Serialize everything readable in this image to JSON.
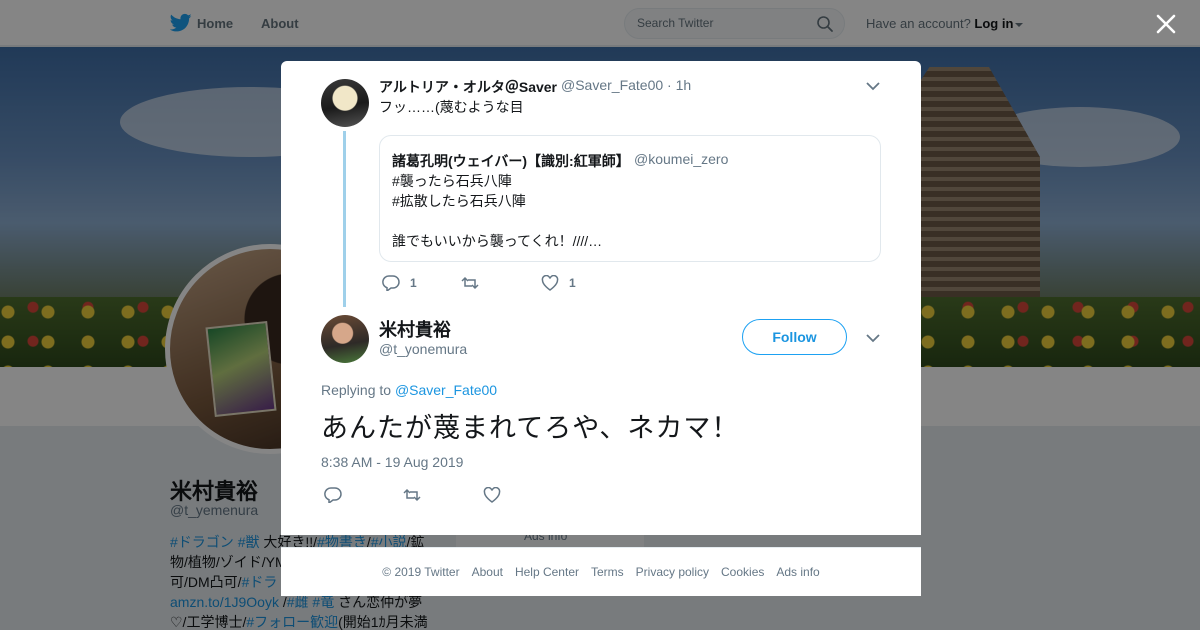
{
  "topbar": {
    "home_label": "Home",
    "about_label": "About",
    "search_placeholder": "Search Twitter",
    "have_account": "Have an account?",
    "login_label": "Log in"
  },
  "profile": {
    "name": "米村貴裕",
    "handle": "@t_yemenura",
    "bio": {
      "l1a": "#ドラゴン",
      "l1b": "#獣",
      "l1c": " 大好き!!/",
      "l1d": "#物書き",
      "l1e": "/",
      "l1f": "#小説",
      "l1g": "/鉱",
      "l2": "物/植物/ゾイド/YM",
      "l3a": "可/DM凸可/",
      "l3b": "#ドラ",
      "l4a": "amzn.to/1J9Ooyk",
      "l4b": " /",
      "l4c": "#雌",
      "l4d": " ",
      "l4e": "#竜",
      "l4f": " さん恋仲が夢",
      "l5a": "♡/工学博士/",
      "l5b": "#フォロー歓迎",
      "l5c": "(開始1ｶ月未満"
    }
  },
  "side": {
    "ads_info": "Ads info"
  },
  "modal": {
    "tweet1": {
      "name": "アルトリア・オルタ＠Saver",
      "handle": "@Saver_Fate00 · 1h",
      "text": "フッ……(蔑むような目",
      "quote": {
        "name": "諸葛孔明(ウェイバー)【識別:紅軍師】",
        "handle": "@koumei_zero",
        "line1": "#襲ったら石兵八陣",
        "line2": "#拡散したら石兵八陣",
        "line3": "誰でもいいから襲ってくれ！////…"
      },
      "reply_count": "1",
      "like_count": "1"
    },
    "tweet2": {
      "name": "米村貴裕",
      "handle": "@t_yonemura",
      "follow_label": "Follow",
      "replying_prefix": "Replying to",
      "replying_handle": "@Saver_Fate00",
      "text": "あんたが蔑まれてろや、ネカマ！",
      "timestamp": "8:38 AM - 19 Aug 2019"
    }
  },
  "footer": {
    "links": [
      "© 2019 Twitter",
      "About",
      "Help Center",
      "Terms",
      "Privacy policy",
      "Cookies",
      "Ads info"
    ]
  },
  "colors": {
    "brand": "#1da1f2",
    "link": "#1b95e0",
    "muted": "#657786",
    "thread": "#9fd0ea"
  },
  "icons": [
    "twitter-bird-icon",
    "search-icon",
    "close-icon",
    "chevron-down-icon",
    "reply-icon",
    "retweet-icon",
    "like-icon"
  ]
}
